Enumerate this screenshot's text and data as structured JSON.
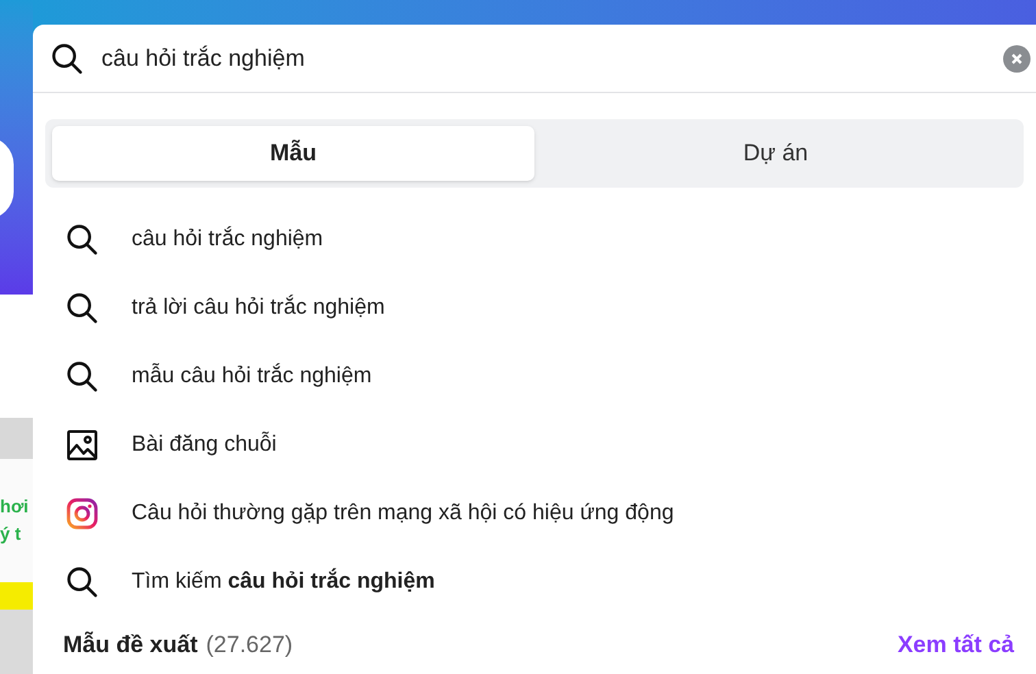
{
  "background": {
    "thumbnail_texts": [
      "hơi",
      "ý t"
    ]
  },
  "search": {
    "value": "câu hỏi trắc nghiệm"
  },
  "tabs": [
    {
      "label": "Mẫu",
      "selected": true
    },
    {
      "label": "Dự án",
      "selected": false
    }
  ],
  "suggestions": [
    {
      "kind": "search",
      "text": "câu hỏi trắc nghiệm"
    },
    {
      "kind": "search",
      "text": "trả lời câu hỏi trắc nghiệm"
    },
    {
      "kind": "search",
      "text": "mẫu câu hỏi trắc nghiệm"
    },
    {
      "kind": "image",
      "text": "Bài đăng chuỗi"
    },
    {
      "kind": "instagram",
      "text": "Câu hỏi thường gặp trên mạng xã hội có hiệu ứng động"
    },
    {
      "kind": "search",
      "text": "Tìm kiếm **câu hỏi trắc nghiệm**"
    }
  ],
  "footer": {
    "title": "Mẫu đề xuất",
    "count": "(27.627)",
    "link": "Xem tất cả"
  }
}
